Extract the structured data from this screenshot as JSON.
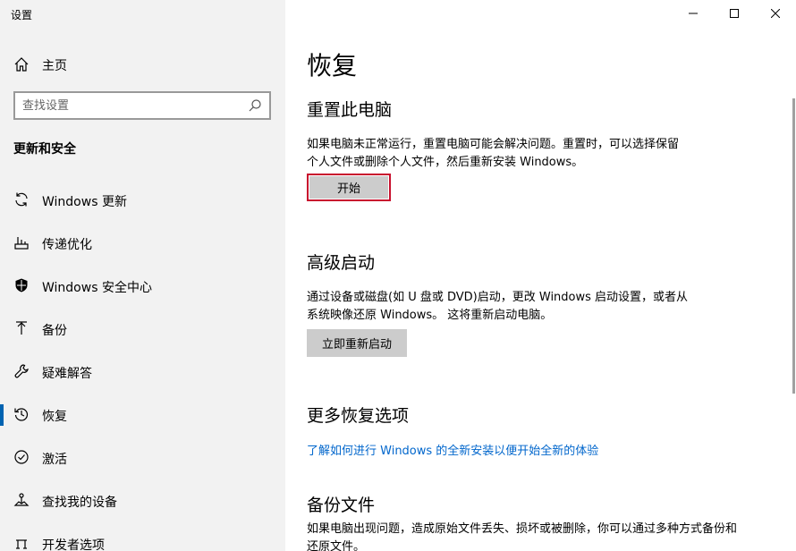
{
  "window": {
    "title": "设置",
    "controls": [
      "minimize",
      "maximize",
      "close"
    ]
  },
  "sidebar": {
    "home_label": "主页",
    "search_placeholder": "查找设置",
    "section_title": "更新和安全",
    "items": [
      {
        "label": "Windows 更新",
        "icon": "sync-icon",
        "selected": false
      },
      {
        "label": "传递优化",
        "icon": "delivery-optimization-icon",
        "selected": false
      },
      {
        "label": "Windows 安全中心",
        "icon": "shield-icon",
        "selected": false
      },
      {
        "label": "备份",
        "icon": "backup-arrow-icon",
        "selected": false
      },
      {
        "label": "疑难解答",
        "icon": "wrench-icon",
        "selected": false
      },
      {
        "label": "恢复",
        "icon": "recovery-icon",
        "selected": true
      },
      {
        "label": "激活",
        "icon": "check-circle-icon",
        "selected": false
      },
      {
        "label": "查找我的设备",
        "icon": "find-device-icon",
        "selected": false
      },
      {
        "label": "开发者选项",
        "icon": "developer-icon",
        "selected": false
      }
    ]
  },
  "main": {
    "title": "恢复",
    "reset": {
      "heading": "重置此电脑",
      "desc_line1": "如果电脑未正常运行，重置电脑可能会解决问题。重置时，可以选择保留",
      "desc_line2": "个人文件或删除个人文件，然后重新安装 Windows。",
      "button": "开始"
    },
    "advanced": {
      "heading": "高级启动",
      "desc_line1": "通过设备或磁盘(如 U 盘或 DVD)启动，更改 Windows 启动设置，或者从",
      "desc_line2": "系统映像还原 Windows。 这将重新启动电脑。",
      "button": "立即重新启动"
    },
    "more": {
      "heading": "更多恢复选项",
      "link": "了解如何进行 Windows 的全新安装以便开始全新的体验"
    },
    "backup": {
      "heading": "备份文件",
      "desc_line1": "如果电脑出现问题，造成原始文件丢失、损坏或被删除，你可以通过多种方式备份和",
      "desc_line2": "还原文件。"
    }
  },
  "colors": {
    "sidebar_bg": "#f2f2f2",
    "accent": "#0063b1",
    "link": "#0066cc",
    "focus_border": "#c8102e",
    "button_bg": "#cccccc"
  }
}
